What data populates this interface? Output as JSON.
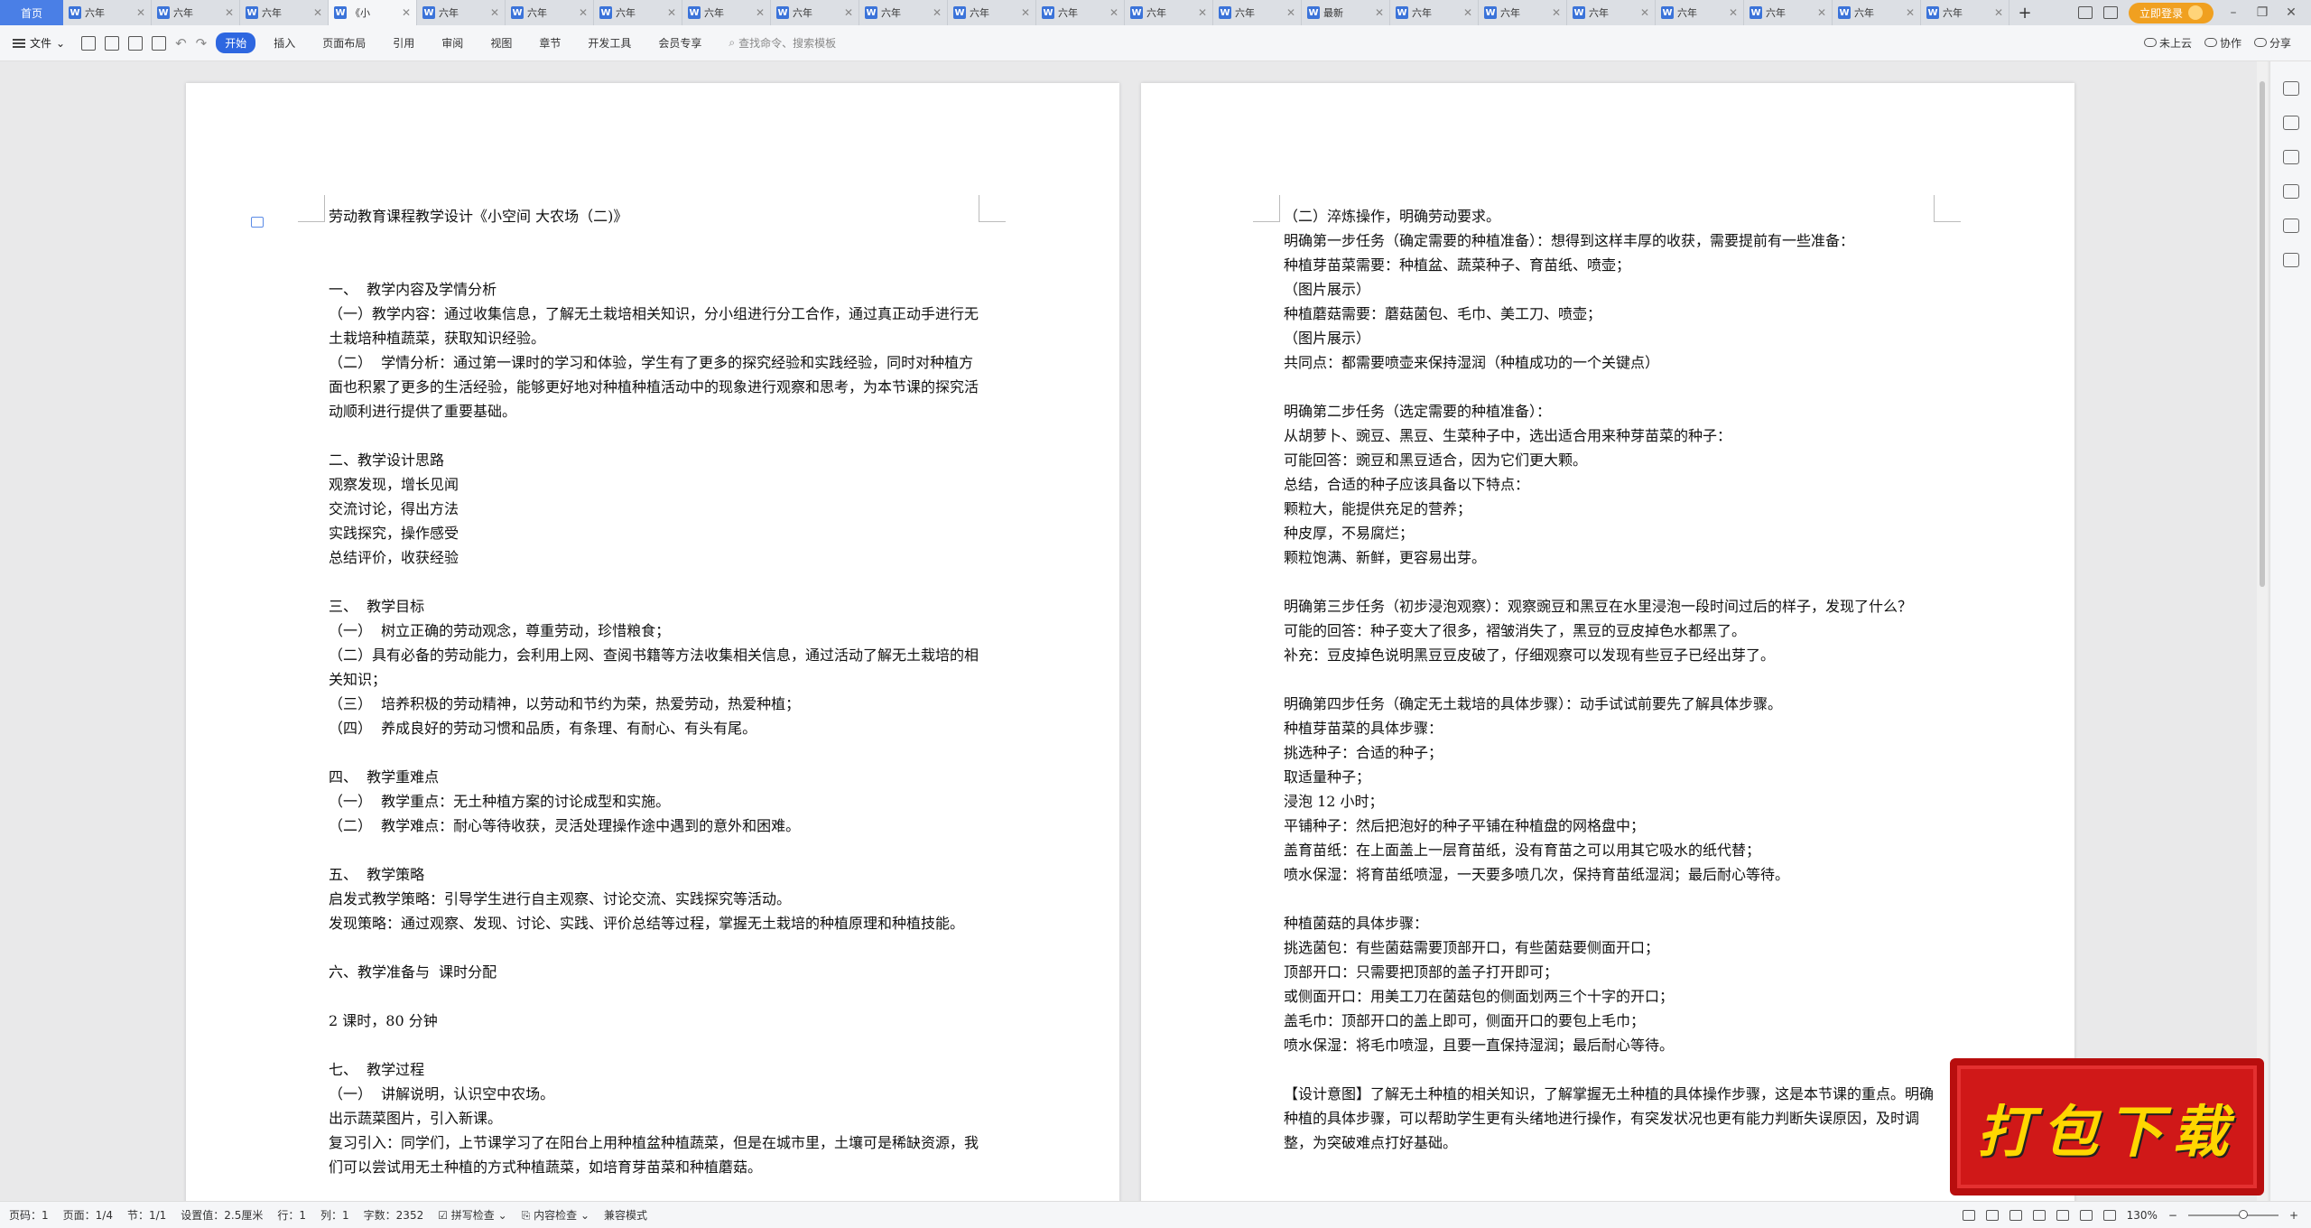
{
  "tabbar": {
    "home_label": "首页",
    "tabs": [
      "六年",
      "六年",
      "六年",
      "《小",
      "六年",
      "六年",
      "六年",
      "六年",
      "六年",
      "六年",
      "六年",
      "六年",
      "六年",
      "六年",
      "最新",
      "六年",
      "六年",
      "六年",
      "六年",
      "六年",
      "六年",
      "六年"
    ],
    "active_index": 3,
    "add_label": "+",
    "login_label": "立即登录"
  },
  "ribbon": {
    "file_label": "文件",
    "tabs": [
      "开始",
      "插入",
      "页面布局",
      "引用",
      "审阅",
      "视图",
      "章节",
      "开发工具",
      "会员专享"
    ],
    "active_tab": 0,
    "search_placeholder": "查找命令、搜索模板",
    "cloud_label": "未上云",
    "collab_label": "协作",
    "share_label": "分享"
  },
  "left_page": [
    "劳动教育课程教学设计《小空间 大农场（二)》",
    "",
    "",
    "一、  教学内容及学情分析",
    "（一）教学内容：通过收集信息，了解无土栽培相关知识，分小组进行分工合作，通过真正动手进行无土栽培种植蔬菜，获取知识经验。",
    "（二）  学情分析：通过第一课时的学习和体验，学生有了更多的探究经验和实践经验，同时对种植方面也积累了更多的生活经验，能够更好地对种植种植活动中的现象进行观察和思考，为本节课的探究活动顺利进行提供了重要基础。",
    "",
    "二、教学设计思路",
    "观察发现，增长见闻",
    "交流讨论，得出方法",
    "实践探究，操作感受",
    "总结评价，收获经验",
    "",
    "三、  教学目标",
    "（一）  树立正确的劳动观念，尊重劳动，珍惜粮食；",
    "（二）具有必备的劳动能力，会利用上网、查阅书籍等方法收集相关信息，通过活动了解无土栽培的相关知识；",
    "（三）  培养积极的劳动精神，以劳动和节约为荣，热爱劳动，热爱种植；",
    "（四）  养成良好的劳动习惯和品质，有条理、有耐心、有头有尾。",
    "",
    "四、  教学重难点",
    "（一）  教学重点：无土种植方案的讨论成型和实施。",
    "（二）  教学难点：耐心等待收获，灵活处理操作途中遇到的意外和困难。",
    "",
    "五、  教学策略",
    "启发式教学策略：引导学生进行自主观察、讨论交流、实践探究等活动。",
    "发现策略：通过观察、发现、讨论、实践、评价总结等过程，掌握无土栽培的种植原理和种植技能。",
    "",
    "六、教学准备与  课时分配",
    "",
    "2 课时，80 分钟",
    "",
    "七、  教学过程",
    "（一）  讲解说明，认识空中农场。",
    "出示蔬菜图片，引入新课。",
    "复习引入：同学们，上节课学习了在阳台上用种植盆种植蔬菜，但是在城市里，土壤可是稀缺资源，我们可以尝试用无土种植的方式种植蔬菜，如培育芽苗菜和种植蘑菇。"
  ],
  "right_page": [
    "（二）淬炼操作，明确劳动要求。",
    "明确第一步任务（确定需要的种植准备）：想得到这样丰厚的收获，需要提前有一些准备：",
    "种植芽苗菜需要：种植盆、蔬菜种子、育苗纸、喷壶；",
    "（图片展示）",
    "种植蘑菇需要：蘑菇菌包、毛巾、美工刀、喷壶；",
    "（图片展示）",
    "共同点：都需要喷壶来保持湿润（种植成功的一个关键点）",
    "",
    "明确第二步任务（选定需要的种植准备）：",
    "从胡萝卜、豌豆、黑豆、生菜种子中，选出适合用来种芽苗菜的种子：",
    "可能回答：豌豆和黑豆适合，因为它们更大颗。",
    "总结，合适的种子应该具备以下特点：",
    "颗粒大，能提供充足的营养；",
    "种皮厚，不易腐烂；",
    "颗粒饱满、新鲜，更容易出芽。",
    "",
    "明确第三步任务（初步浸泡观察）：观察豌豆和黑豆在水里浸泡一段时间过后的样子，发现了什么？",
    "可能的回答：种子变大了很多，褶皱消失了，黑豆的豆皮掉色水都黑了。",
    "补充：豆皮掉色说明黑豆豆皮破了，仔细观察可以发现有些豆子已经出芽了。",
    "",
    "明确第四步任务（确定无土栽培的具体步骤）：动手试试前要先了解具体步骤。",
    "种植芽苗菜的具体步骤：",
    "挑选种子：合适的种子；",
    "取适量种子；",
    "浸泡 12 小时；",
    "平铺种子：然后把泡好的种子平铺在种植盘的网格盘中；",
    "盖育苗纸：在上面盖上一层育苗纸，没有育苗之可以用其它吸水的纸代替；",
    "喷水保湿：将育苗纸喷湿，一天要多喷几次，保持育苗纸湿润；最后耐心等待。",
    "",
    "种植菌菇的具体步骤：",
    "挑选菌包：有些菌菇需要顶部开口，有些菌菇要侧面开口；",
    "顶部开口：只需要把顶部的盖子打开即可；",
    "或侧面开口：用美工刀在菌菇包的侧面划两三个十字的开口；",
    "盖毛巾：顶部开口的盖上即可，侧面开口的要包上毛巾；",
    "喷水保湿：将毛巾喷湿，且要一直保持湿润；最后耐心等待。",
    "",
    "【设计意图】了解无土种植的相关知识，了解掌握无土种植的具体操作步骤，这是本节课的重点。明确种植的具体步骤，可以帮助学生更有头绪地进行操作，有突发状况也更有能力判断失误原因，及时调整，为突破难点打好基础。"
  ],
  "statusbar": {
    "page_num": "页码：1",
    "page_of": "页面：1/4",
    "section": "节：1/1",
    "setting": "设置值：2.5厘米",
    "row": "行：1",
    "col": "列：1",
    "word_count": "字数：2352",
    "spell_check": "拼写检查",
    "content_check": "内容检查",
    "compat_mode": "兼容模式",
    "zoom": "130%"
  },
  "banner": {
    "text": "打包下载"
  },
  "colors": {
    "accent": "#2e67e0",
    "banner_bg": "#d01818",
    "banner_text": "#ffd600"
  }
}
